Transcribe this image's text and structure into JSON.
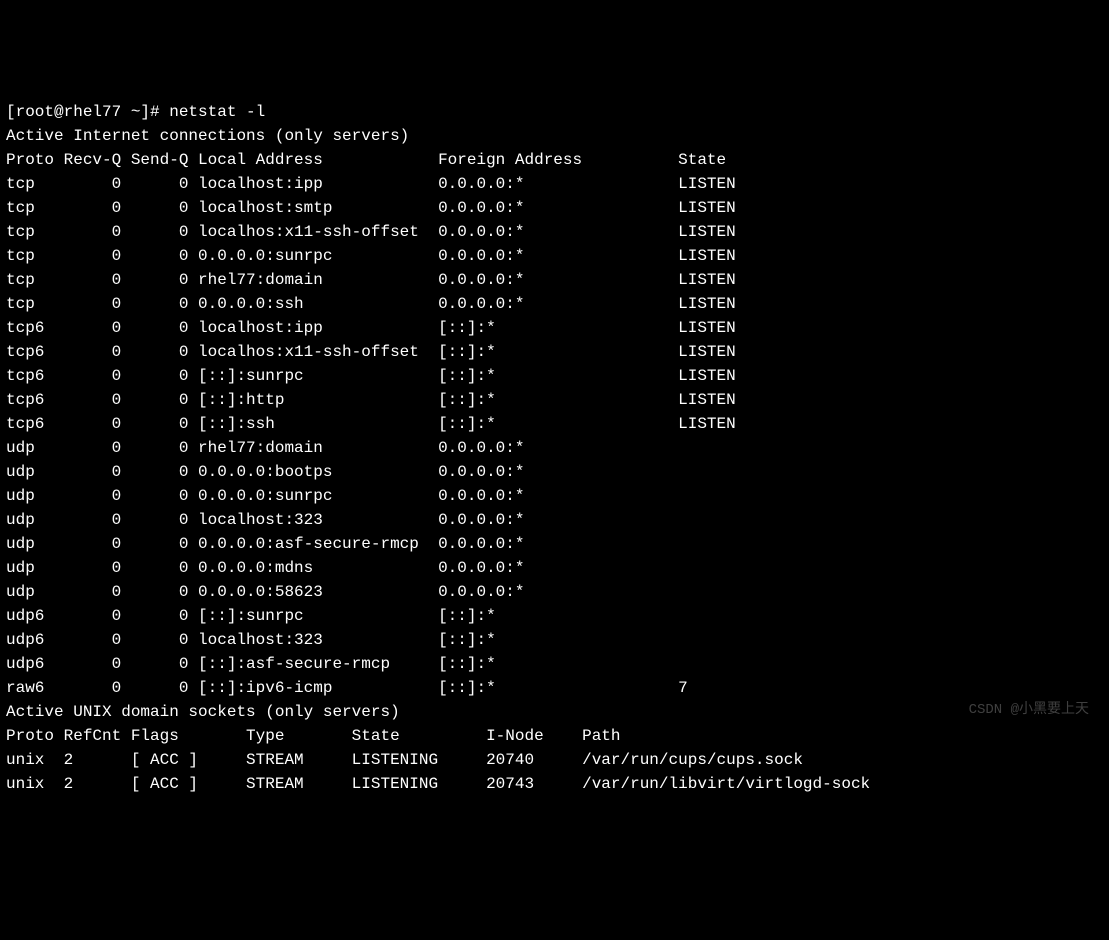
{
  "prompt": {
    "user": "root",
    "host": "rhel77",
    "cwd": "~",
    "symbol": "#",
    "command": "netstat -l"
  },
  "section_headers": {
    "internet": "Active Internet connections (only servers)",
    "unix": "Active UNIX domain sockets (only servers)"
  },
  "internet_columns": {
    "proto": "Proto",
    "recvq": "Recv-Q",
    "sendq": "Send-Q",
    "local": "Local Address",
    "foreign": "Foreign Address",
    "state": "State"
  },
  "internet_rows": [
    {
      "proto": "tcp",
      "recvq": "0",
      "sendq": "0",
      "local": "localhost:ipp",
      "foreign": "0.0.0.0:*",
      "state": "LISTEN"
    },
    {
      "proto": "tcp",
      "recvq": "0",
      "sendq": "0",
      "local": "localhost:smtp",
      "foreign": "0.0.0.0:*",
      "state": "LISTEN"
    },
    {
      "proto": "tcp",
      "recvq": "0",
      "sendq": "0",
      "local": "localhos:x11-ssh-offset",
      "foreign": "0.0.0.0:*",
      "state": "LISTEN"
    },
    {
      "proto": "tcp",
      "recvq": "0",
      "sendq": "0",
      "local": "0.0.0.0:sunrpc",
      "foreign": "0.0.0.0:*",
      "state": "LISTEN"
    },
    {
      "proto": "tcp",
      "recvq": "0",
      "sendq": "0",
      "local": "rhel77:domain",
      "foreign": "0.0.0.0:*",
      "state": "LISTEN"
    },
    {
      "proto": "tcp",
      "recvq": "0",
      "sendq": "0",
      "local": "0.0.0.0:ssh",
      "foreign": "0.0.0.0:*",
      "state": "LISTEN"
    },
    {
      "proto": "tcp6",
      "recvq": "0",
      "sendq": "0",
      "local": "localhost:ipp",
      "foreign": "[::]:*",
      "state": "LISTEN"
    },
    {
      "proto": "tcp6",
      "recvq": "0",
      "sendq": "0",
      "local": "localhos:x11-ssh-offset",
      "foreign": "[::]:*",
      "state": "LISTEN"
    },
    {
      "proto": "tcp6",
      "recvq": "0",
      "sendq": "0",
      "local": "[::]:sunrpc",
      "foreign": "[::]:*",
      "state": "LISTEN"
    },
    {
      "proto": "tcp6",
      "recvq": "0",
      "sendq": "0",
      "local": "[::]:http",
      "foreign": "[::]:*",
      "state": "LISTEN"
    },
    {
      "proto": "tcp6",
      "recvq": "0",
      "sendq": "0",
      "local": "[::]:ssh",
      "foreign": "[::]:*",
      "state": "LISTEN"
    },
    {
      "proto": "udp",
      "recvq": "0",
      "sendq": "0",
      "local": "rhel77:domain",
      "foreign": "0.0.0.0:*",
      "state": ""
    },
    {
      "proto": "udp",
      "recvq": "0",
      "sendq": "0",
      "local": "0.0.0.0:bootps",
      "foreign": "0.0.0.0:*",
      "state": ""
    },
    {
      "proto": "udp",
      "recvq": "0",
      "sendq": "0",
      "local": "0.0.0.0:sunrpc",
      "foreign": "0.0.0.0:*",
      "state": ""
    },
    {
      "proto": "udp",
      "recvq": "0",
      "sendq": "0",
      "local": "localhost:323",
      "foreign": "0.0.0.0:*",
      "state": ""
    },
    {
      "proto": "udp",
      "recvq": "0",
      "sendq": "0",
      "local": "0.0.0.0:asf-secure-rmcp",
      "foreign": "0.0.0.0:*",
      "state": ""
    },
    {
      "proto": "udp",
      "recvq": "0",
      "sendq": "0",
      "local": "0.0.0.0:mdns",
      "foreign": "0.0.0.0:*",
      "state": ""
    },
    {
      "proto": "udp",
      "recvq": "0",
      "sendq": "0",
      "local": "0.0.0.0:58623",
      "foreign": "0.0.0.0:*",
      "state": ""
    },
    {
      "proto": "udp6",
      "recvq": "0",
      "sendq": "0",
      "local": "[::]:sunrpc",
      "foreign": "[::]:*",
      "state": ""
    },
    {
      "proto": "udp6",
      "recvq": "0",
      "sendq": "0",
      "local": "localhost:323",
      "foreign": "[::]:*",
      "state": ""
    },
    {
      "proto": "udp6",
      "recvq": "0",
      "sendq": "0",
      "local": "[::]:asf-secure-rmcp",
      "foreign": "[::]:*",
      "state": ""
    },
    {
      "proto": "raw6",
      "recvq": "0",
      "sendq": "0",
      "local": "[::]:ipv6-icmp",
      "foreign": "[::]:*",
      "state": "7"
    }
  ],
  "unix_columns": {
    "proto": "Proto",
    "refcnt": "RefCnt",
    "flags": "Flags",
    "type": "Type",
    "state": "State",
    "inode": "I-Node",
    "path": "Path"
  },
  "unix_rows": [
    {
      "proto": "unix",
      "refcnt": "2",
      "flags": "[ ACC ]",
      "type": "STREAM",
      "state": "LISTENING",
      "inode": "20740",
      "path": "/var/run/cups/cups.sock"
    },
    {
      "proto": "unix",
      "refcnt": "2",
      "flags": "[ ACC ]",
      "type": "STREAM",
      "state": "LISTENING",
      "inode": "20743",
      "path": "/var/run/libvirt/virtlogd-sock"
    }
  ],
  "watermark": "CSDN @小黑要上天"
}
